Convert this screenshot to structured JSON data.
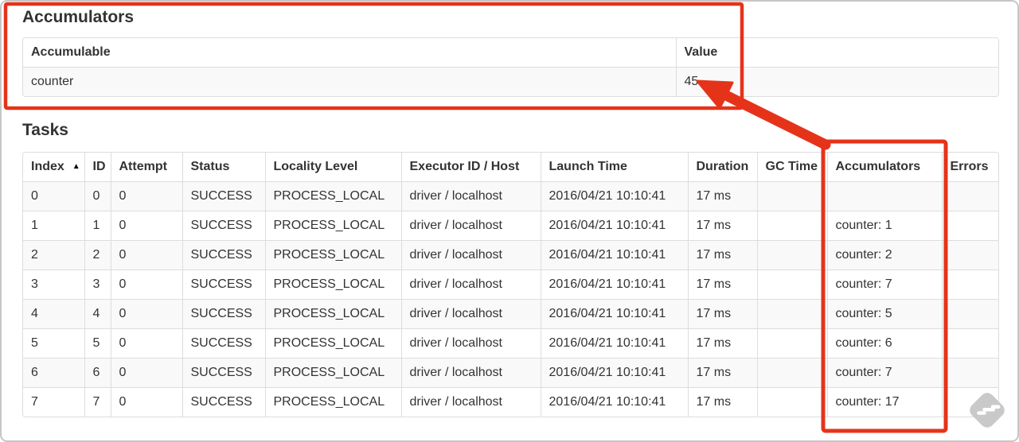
{
  "accumulators_section": {
    "heading": "Accumulators",
    "table": {
      "headers": [
        "Accumulable",
        "Value"
      ],
      "rows": [
        {
          "accumulable": "counter",
          "value": "45"
        }
      ]
    }
  },
  "tasks_section": {
    "heading": "Tasks",
    "table": {
      "sort_icon": "▲",
      "headers": [
        "Index",
        "ID",
        "Attempt",
        "Status",
        "Locality Level",
        "Executor ID / Host",
        "Launch Time",
        "Duration",
        "GC Time",
        "Accumulators",
        "Errors"
      ],
      "rows": [
        {
          "index": "0",
          "id": "0",
          "attempt": "0",
          "status": "SUCCESS",
          "locality": "PROCESS_LOCAL",
          "executor": "driver / localhost",
          "launch": "2016/04/21 10:10:41",
          "duration": "17 ms",
          "gc": "",
          "accumulators": "",
          "errors": ""
        },
        {
          "index": "1",
          "id": "1",
          "attempt": "0",
          "status": "SUCCESS",
          "locality": "PROCESS_LOCAL",
          "executor": "driver / localhost",
          "launch": "2016/04/21 10:10:41",
          "duration": "17 ms",
          "gc": "",
          "accumulators": "counter: 1",
          "errors": ""
        },
        {
          "index": "2",
          "id": "2",
          "attempt": "0",
          "status": "SUCCESS",
          "locality": "PROCESS_LOCAL",
          "executor": "driver / localhost",
          "launch": "2016/04/21 10:10:41",
          "duration": "17 ms",
          "gc": "",
          "accumulators": "counter: 2",
          "errors": ""
        },
        {
          "index": "3",
          "id": "3",
          "attempt": "0",
          "status": "SUCCESS",
          "locality": "PROCESS_LOCAL",
          "executor": "driver / localhost",
          "launch": "2016/04/21 10:10:41",
          "duration": "17 ms",
          "gc": "",
          "accumulators": "counter: 7",
          "errors": ""
        },
        {
          "index": "4",
          "id": "4",
          "attempt": "0",
          "status": "SUCCESS",
          "locality": "PROCESS_LOCAL",
          "executor": "driver / localhost",
          "launch": "2016/04/21 10:10:41",
          "duration": "17 ms",
          "gc": "",
          "accumulators": "counter: 5",
          "errors": ""
        },
        {
          "index": "5",
          "id": "5",
          "attempt": "0",
          "status": "SUCCESS",
          "locality": "PROCESS_LOCAL",
          "executor": "driver / localhost",
          "launch": "2016/04/21 10:10:41",
          "duration": "17 ms",
          "gc": "",
          "accumulators": "counter: 6",
          "errors": ""
        },
        {
          "index": "6",
          "id": "6",
          "attempt": "0",
          "status": "SUCCESS",
          "locality": "PROCESS_LOCAL",
          "executor": "driver / localhost",
          "launch": "2016/04/21 10:10:41",
          "duration": "17 ms",
          "gc": "",
          "accumulators": "counter: 7",
          "errors": ""
        },
        {
          "index": "7",
          "id": "7",
          "attempt": "0",
          "status": "SUCCESS",
          "locality": "PROCESS_LOCAL",
          "executor": "driver / localhost",
          "launch": "2016/04/21 10:10:41",
          "duration": "17 ms",
          "gc": "",
          "accumulators": "counter: 17",
          "errors": ""
        }
      ]
    }
  },
  "annotations": {
    "color": "#e5331a"
  },
  "watermark": {
    "color": "#c9c9c9"
  }
}
